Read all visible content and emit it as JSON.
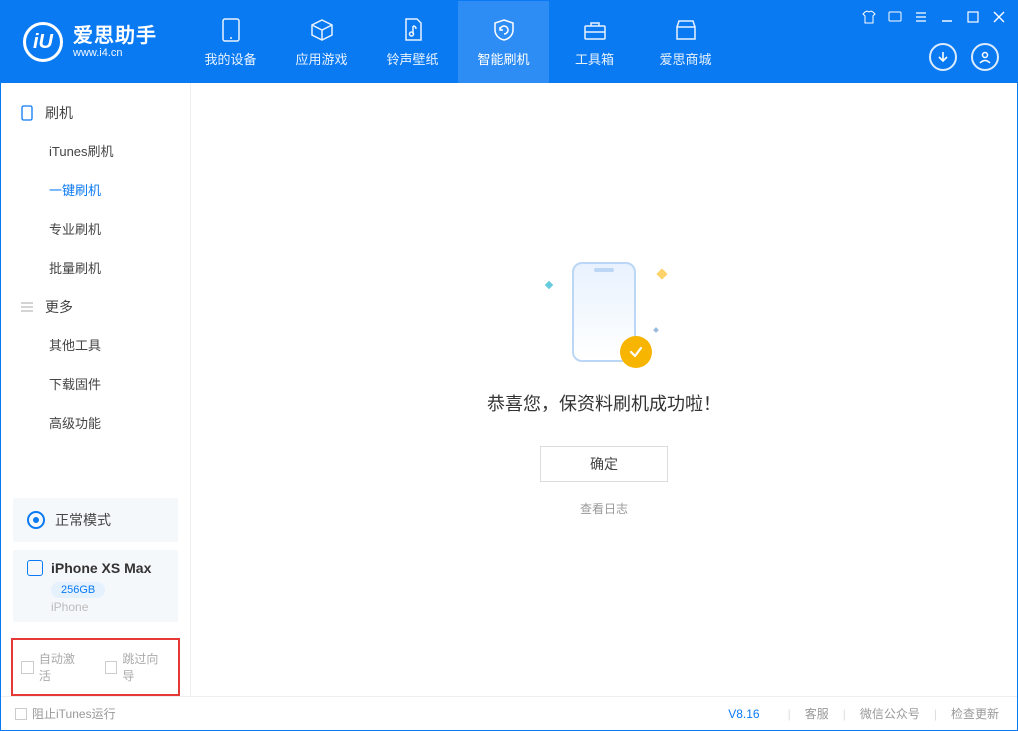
{
  "app": {
    "title": "爱思助手",
    "site": "www.i4.cn"
  },
  "nav": {
    "items": [
      {
        "label": "我的设备"
      },
      {
        "label": "应用游戏"
      },
      {
        "label": "铃声壁纸"
      },
      {
        "label": "智能刷机"
      },
      {
        "label": "工具箱"
      },
      {
        "label": "爱思商城"
      }
    ]
  },
  "sidebar": {
    "group1_title": "刷机",
    "group1_items": [
      {
        "label": "iTunes刷机"
      },
      {
        "label": "一键刷机"
      },
      {
        "label": "专业刷机"
      },
      {
        "label": "批量刷机"
      }
    ],
    "group2_title": "更多",
    "group2_items": [
      {
        "label": "其他工具"
      },
      {
        "label": "下载固件"
      },
      {
        "label": "高级功能"
      }
    ],
    "mode_label": "正常模式",
    "device_name": "iPhone XS Max",
    "device_storage": "256GB",
    "device_type": "iPhone",
    "auto_activate_label": "自动激活",
    "skip_guide_label": "跳过向导"
  },
  "main": {
    "success_message": "恭喜您，保资料刷机成功啦！",
    "ok_button": "确定",
    "view_log": "查看日志"
  },
  "footer": {
    "block_itunes": "阻止iTunes运行",
    "version": "V8.16",
    "link_support": "客服",
    "link_wechat": "微信公众号",
    "link_update": "检查更新"
  }
}
